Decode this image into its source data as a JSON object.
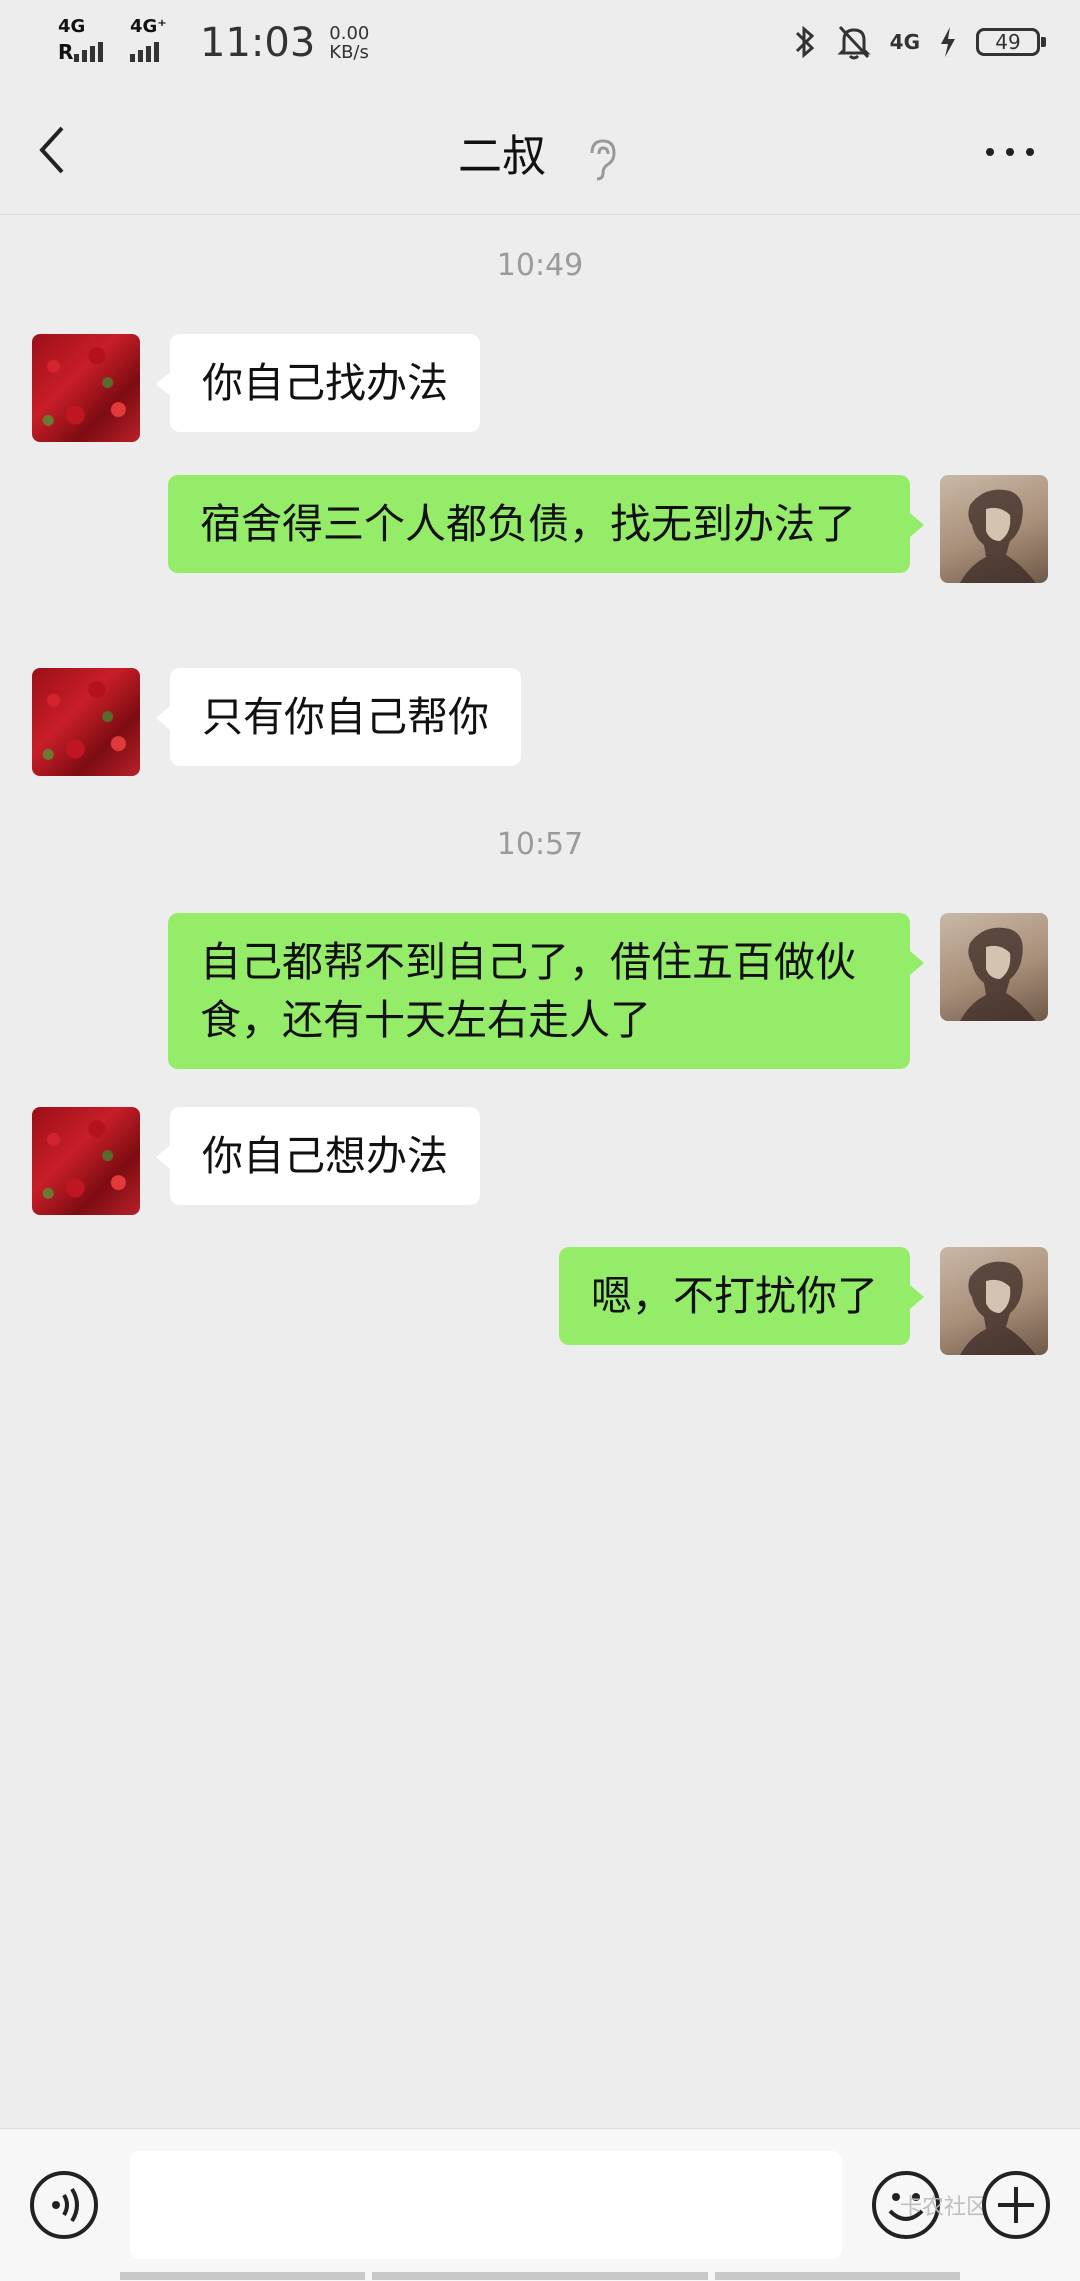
{
  "status_bar": {
    "sim1": "4G",
    "sim1_roaming": "R",
    "sim2": "4G⁺",
    "time": "11:03",
    "speed_value": "0.00",
    "speed_unit": "KB/s",
    "network": "4G",
    "battery": "49"
  },
  "header": {
    "title": "二叔"
  },
  "messages": [
    {
      "type": "timestamp",
      "text": "10:49"
    },
    {
      "type": "in",
      "text": "你自己找办法"
    },
    {
      "type": "out",
      "text": "宿舍得三个人都负债，找无到办法了"
    },
    {
      "type": "in",
      "text": "只有你自己帮你"
    },
    {
      "type": "timestamp",
      "text": "10:57"
    },
    {
      "type": "out",
      "text": "自己都帮不到自己了，借住五百做伙食，还有十天左右走人了"
    },
    {
      "type": "in",
      "text": "你自己想办法"
    },
    {
      "type": "out",
      "text": "嗯，不打扰你了"
    }
  ],
  "input_bar": {
    "message_placeholder": "",
    "watermark": "卡农社区"
  },
  "colors": {
    "background": "#ededed",
    "outgoing_bubble": "#95ec69",
    "incoming_bubble": "#ffffff"
  }
}
